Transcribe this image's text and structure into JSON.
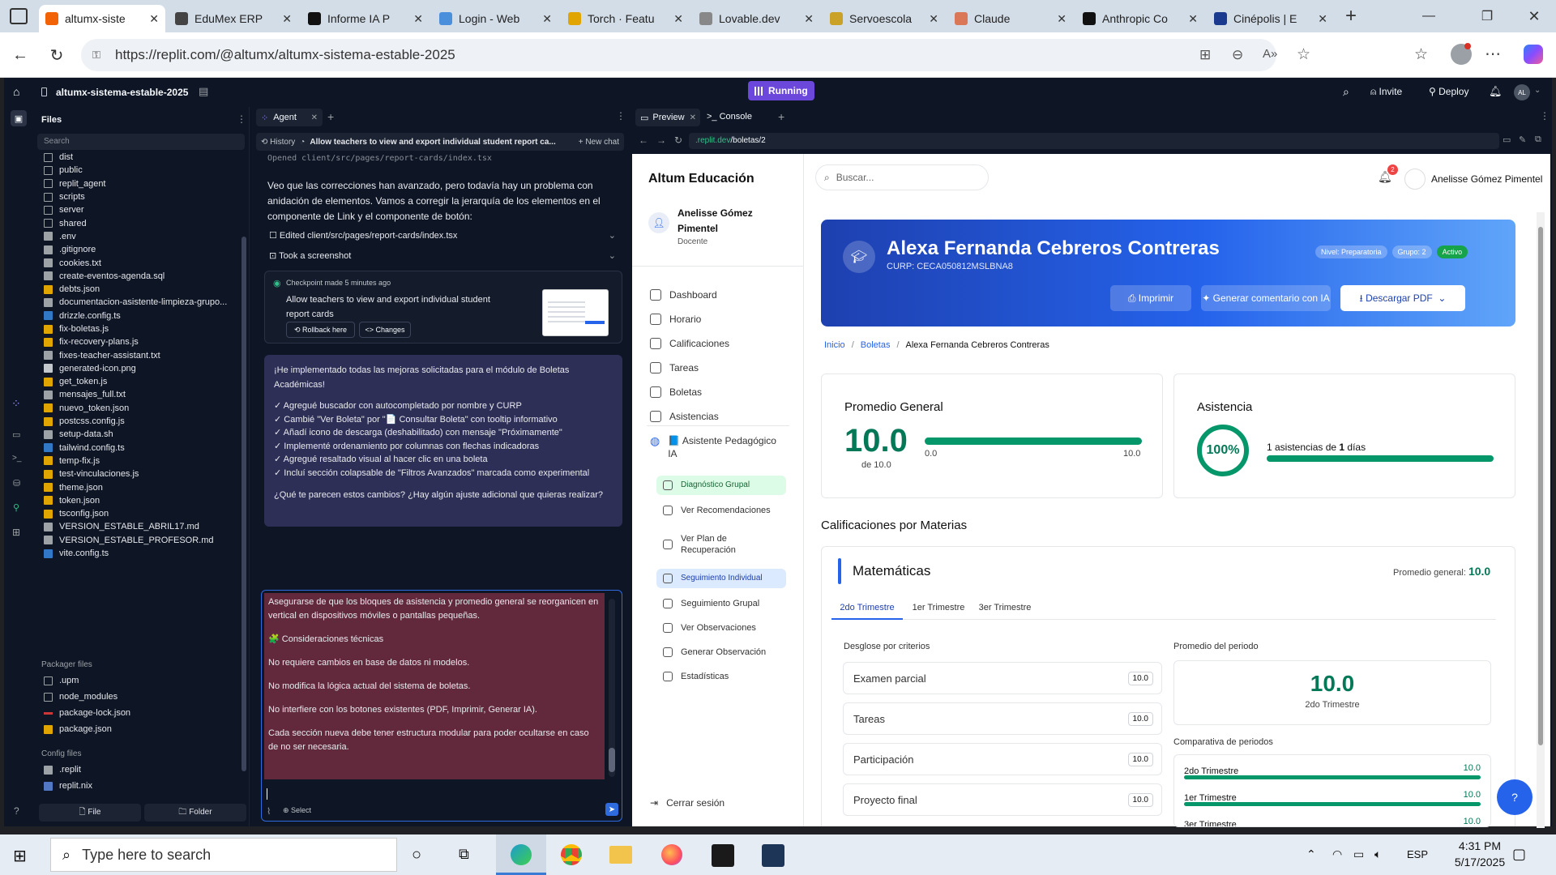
{
  "browser": {
    "tabs": [
      {
        "title": "altumx-siste",
        "color": "#f26207"
      },
      {
        "title": "EduMex ERP",
        "color": "#444"
      },
      {
        "title": "Informe IA P",
        "color": "#111"
      },
      {
        "title": "Login - Web",
        "color": "#4a8fdc"
      },
      {
        "title": "Torch · Featu",
        "color": "#e0a500"
      },
      {
        "title": "Lovable.dev",
        "color": "#888"
      },
      {
        "title": "Servoescola",
        "color": "#c9a227"
      },
      {
        "title": "Claude",
        "color": "#d97757"
      },
      {
        "title": "Anthropic Co",
        "color": "#111"
      },
      {
        "title": "Cinépolis | E",
        "color": "#1a3a8f"
      }
    ],
    "url": "https://replit.com/@altumx/altumx-sistema-estable-2025"
  },
  "replit": {
    "project": "altumx-sistema-estable-2025",
    "status": "Running",
    "invite": "Invite",
    "deploy": "Deploy",
    "avatar": "AL",
    "files_title": "Files",
    "search_placeholder": "Search",
    "files": [
      {
        "name": "dist",
        "type": "folder"
      },
      {
        "name": "public",
        "type": "folder"
      },
      {
        "name": "replit_agent",
        "type": "folder"
      },
      {
        "name": "scripts",
        "type": "folder"
      },
      {
        "name": "server",
        "type": "folder"
      },
      {
        "name": "shared",
        "type": "folder"
      },
      {
        "name": ".env",
        "type": "file"
      },
      {
        "name": ".gitignore",
        "type": "file"
      },
      {
        "name": "cookies.txt",
        "type": "file"
      },
      {
        "name": "create-eventos-agenda.sql",
        "type": "file"
      },
      {
        "name": "debts.json",
        "type": "json"
      },
      {
        "name": "documentacion-asistente-limpieza-grupo...",
        "type": "file"
      },
      {
        "name": "drizzle.config.ts",
        "type": "ts"
      },
      {
        "name": "fix-boletas.js",
        "type": "js"
      },
      {
        "name": "fix-recovery-plans.js",
        "type": "js"
      },
      {
        "name": "fixes-teacher-assistant.txt",
        "type": "file"
      },
      {
        "name": "generated-icon.png",
        "type": "img"
      },
      {
        "name": "get_token.js",
        "type": "js"
      },
      {
        "name": "mensajes_full.txt",
        "type": "file"
      },
      {
        "name": "nuevo_token.json",
        "type": "json"
      },
      {
        "name": "postcss.config.js",
        "type": "js"
      },
      {
        "name": "setup-data.sh",
        "type": "file"
      },
      {
        "name": "tailwind.config.ts",
        "type": "ts"
      },
      {
        "name": "temp-fix.js",
        "type": "js"
      },
      {
        "name": "test-vinculaciones.js",
        "type": "js"
      },
      {
        "name": "theme.json",
        "type": "json"
      },
      {
        "name": "token.json",
        "type": "json"
      },
      {
        "name": "tsconfig.json",
        "type": "json"
      },
      {
        "name": "VERSION_ESTABLE_ABRIL17.md",
        "type": "file"
      },
      {
        "name": "VERSION_ESTABLE_PROFESOR.md",
        "type": "file"
      },
      {
        "name": "vite.config.ts",
        "type": "ts"
      }
    ],
    "packager_title": "Packager files",
    "packager": [
      {
        "name": ".upm",
        "type": "folder"
      },
      {
        "name": "node_modules",
        "type": "folder"
      },
      {
        "name": "package-lock.json",
        "type": "pkg"
      },
      {
        "name": "package.json",
        "type": "json"
      }
    ],
    "config_title": "Config files",
    "config": [
      {
        "name": ".replit",
        "type": "file"
      },
      {
        "name": "replit.nix",
        "type": "nix"
      }
    ],
    "new_file": "File",
    "new_folder": "Folder"
  },
  "agent": {
    "tab": "Agent",
    "history": "History",
    "thread_title": "Allow teachers to view and export individual student report ca...",
    "new_chat": "New chat",
    "opened": "Opened client/src/pages/report-cards/index.tsx",
    "para1": "Veo que las correcciones han avanzado, pero todavía hay un problema con anidación de elementos. Vamos a corregir la jerarquía de los elementos en el componente de Link y el componente de botón:",
    "edited": "Edited client/src/pages/report-cards/index.tsx",
    "screenshot": "Took a screenshot",
    "checkpoint_meta": "Checkpoint made 5 minutes ago",
    "checkpoint_text": "Allow teachers to view and export individual student report cards",
    "rollback": "Rollback here",
    "changes": "Changes",
    "reply_intro": "¡He implementado todas las mejoras solicitadas para el módulo de Boletas Académicas!",
    "reply_items": [
      "✓ Agregué buscador con autocompletado por nombre y CURP",
      "✓ Cambié \"Ver Boleta\" por \"📄 Consultar Boleta\" con tooltip informativo",
      "✓ Añadí icono de descarga (deshabilitado) con mensaje \"Próximamente\"",
      "✓ Implementé ordenamiento por columnas con flechas indicadoras",
      "✓ Agregué resaltado visual al hacer clic en una boleta",
      "✓ Incluí sección colapsable de \"Filtros Avanzados\" marcada como experimental"
    ],
    "reply_question": "¿Qué te parecen estos cambios? ¿Hay algún ajuste adicional que quieras realizar?",
    "draft": [
      "Asegurarse de que los bloques de asistencia y promedio general se reorganicen en vertical en dispositivos móviles o pantallas pequeñas.",
      "🧩 Consideraciones técnicas",
      "No requiere cambios en base de datos ni modelos.",
      "No modifica la lógica actual del sistema de boletas.",
      "No interfiere con los botones existentes (PDF, Imprimir, Generar IA).",
      "Cada sección nueva debe tener estructura modular para poder ocultarse en caso de no ser necesaria."
    ],
    "select": "Select"
  },
  "preview": {
    "tab_preview": "Preview",
    "tab_console": "Console",
    "url_host": ".replit.dev",
    "url_path": "/boletas/2"
  },
  "app": {
    "brand": "Altum Educación",
    "user_name": "Anelisse Gómez Pimentel",
    "user_role": "Docente",
    "search_placeholder": "Buscar...",
    "notif_count": "2",
    "nav": [
      "Dashboard",
      "Horario",
      "Calificaciones",
      "Tareas",
      "Boletas",
      "Asistencias"
    ],
    "assistant": "📘 Asistente Pedagógico IA",
    "assistant_items": [
      {
        "label": "Diagnóstico Grupal",
        "hl": true
      },
      {
        "label": "Ver Recomendaciones",
        "hl": false
      },
      {
        "label": "Ver Plan de Recuperación",
        "hl": false
      },
      {
        "label": "Seguimiento Individual",
        "hl": true
      },
      {
        "label": "Seguimiento Grupal",
        "hl": false
      },
      {
        "label": "Ver Observaciones",
        "hl": false
      },
      {
        "label": "Generar Observación",
        "hl": false
      },
      {
        "label": "Estadísticas",
        "hl": false
      }
    ],
    "logout": "Cerrar sesión",
    "student": {
      "name": "Alexa Fernanda Cebreros Contreras",
      "curp": "CURP: CECA050812MSLBNA8",
      "badges": [
        "Nivel: Preparatoria",
        "Grupo: 2",
        "Activo"
      ]
    },
    "actions": {
      "print": "Imprimir",
      "ai": "Generar comentario con IA",
      "pdf": "Descargar PDF"
    },
    "breadcrumb": [
      "Inicio",
      "Boletas",
      "Alexa Fernanda Cebreros Contreras"
    ],
    "avg": {
      "title": "Promedio General",
      "value": "10.0",
      "of": "de 10.0",
      "min": "0.0",
      "max": "10.0",
      "progress": 1.0
    },
    "attendance": {
      "title": "Asistencia",
      "percent": "100%",
      "text_pre": "1 asistencias de ",
      "text_bold": "1",
      "text_post": " días",
      "progress": 1.0
    },
    "subjects_title": "Calificaciones por Materias",
    "subject": {
      "name": "Matemáticas",
      "avg_label": "Promedio general:",
      "avg_value": "10.0",
      "terms": [
        "2do Trimestre",
        "1er Trimestre",
        "3er Trimestre"
      ],
      "criteria_title": "Desglose por criterios",
      "criteria": [
        {
          "label": "Examen parcial",
          "value": "10.0"
        },
        {
          "label": "Tareas",
          "value": "10.0"
        },
        {
          "label": "Participación",
          "value": "10.0"
        },
        {
          "label": "Proyecto final",
          "value": "10.0"
        }
      ],
      "period_title": "Promedio del periodo",
      "period_value": "10.0",
      "period_label": "2do Trimestre",
      "compare_title": "Comparativa de periodos",
      "compare": [
        {
          "label": "2do Trimestre",
          "value": "10.0"
        },
        {
          "label": "1er Trimestre",
          "value": "10.0"
        },
        {
          "label": "3er Trimestre",
          "value": "10.0"
        }
      ]
    }
  },
  "taskbar": {
    "search": "Type here to search",
    "time": "4:31 PM",
    "date": "5/17/2025",
    "lang": "ESP"
  },
  "colors": {
    "replit_bg": "#0e1525",
    "accent_blue": "#2563eb",
    "green": "#059669",
    "running": "#6b47dc"
  }
}
